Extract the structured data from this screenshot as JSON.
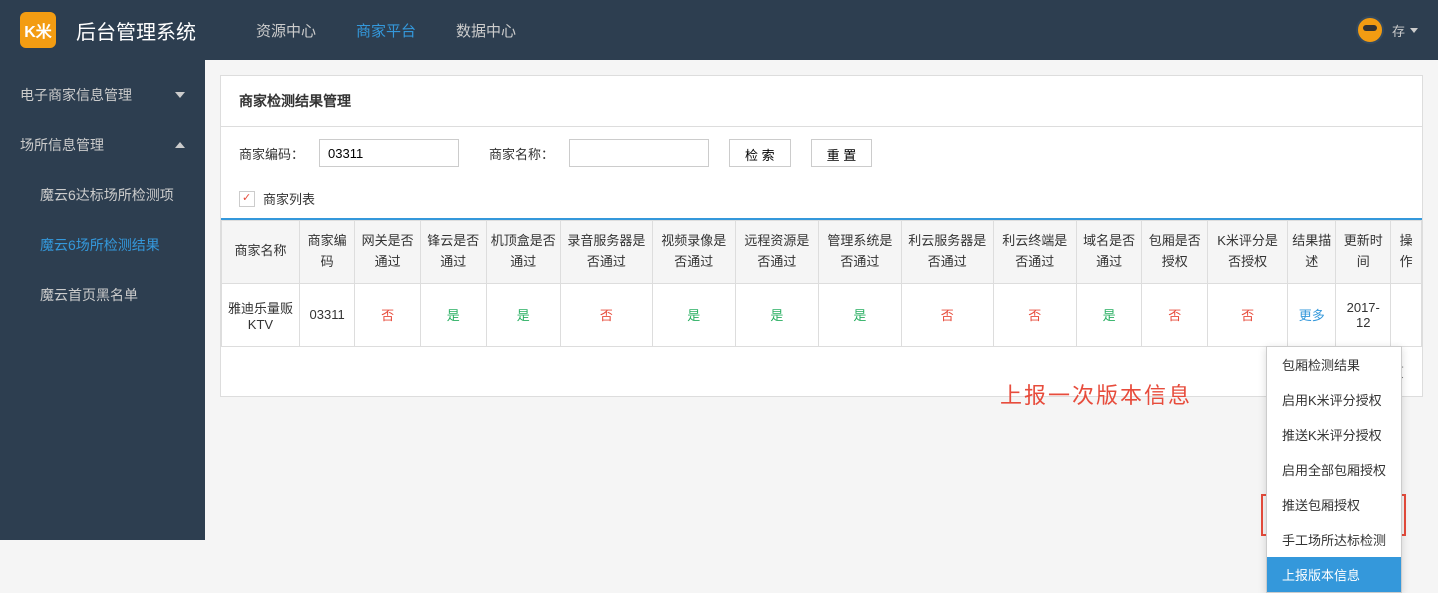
{
  "header": {
    "logo_text": "K米",
    "title": "后台管理系统",
    "nav": [
      "资源中心",
      "商家平台",
      "数据中心"
    ],
    "active_nav": 1,
    "user_label": "存"
  },
  "sidebar": {
    "groups": [
      {
        "label": "电子商家信息管理",
        "expanded": false,
        "items": []
      },
      {
        "label": "场所信息管理",
        "expanded": true,
        "items": [
          {
            "label": "魔云6达标场所检测项",
            "active": false
          },
          {
            "label": "魔云6场所检测结果",
            "active": true
          },
          {
            "label": "魔云首页黑名单",
            "active": false
          }
        ]
      }
    ]
  },
  "panel": {
    "title": "商家检测结果管理",
    "filters": {
      "code_label": "商家编码：",
      "code_value": "03311",
      "name_label": "商家名称：",
      "name_value": "",
      "search_btn": "检 索",
      "reset_btn": "重 置"
    },
    "list_title": "商家列表",
    "columns": [
      "商家名称",
      "商家编码",
      "网关是否通过",
      "锋云是否通过",
      "机顶盒是否通过",
      "录音服务器是否通过",
      "视频录像是否通过",
      "远程资源是否通过",
      "管理系统是否通过",
      "利云服务器是否通过",
      "利云终端是否通过",
      "域名是否通过",
      "包厢是否授权",
      "K米评分是否授权",
      "结果描述",
      "更新时间",
      "操作"
    ],
    "rows": [
      {
        "name": "雅迪乐量贩KTV",
        "code": "03311",
        "vals": [
          "否",
          "是",
          "是",
          "否",
          "是",
          "是",
          "是",
          "否",
          "否",
          "是",
          "否",
          "否"
        ],
        "desc": "更多",
        "time": "2017-12"
      }
    ],
    "dropdown": [
      "包厢检测结果",
      "启用K米评分授权",
      "推送K米评分授权",
      "启用全部包厢授权",
      "推送包厢授权",
      "手工场所达标检测",
      "上报版本信息"
    ],
    "dropdown_highlighted": 6,
    "pagination": "/1 页"
  },
  "annotation": "上报一次版本信息"
}
